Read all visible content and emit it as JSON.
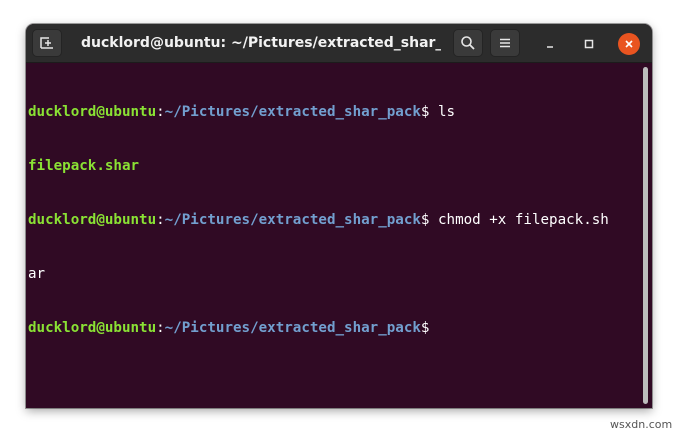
{
  "window": {
    "title": "ducklord@ubuntu: ~/Pictures/extracted_shar_p..."
  },
  "titlebar": {
    "new_tab_icon": "new-tab-icon",
    "search_icon": "search-icon",
    "menu_icon": "hamburger-menu-icon",
    "minimize_icon": "minimize-icon",
    "maximize_icon": "maximize-icon",
    "close_icon": "close-icon"
  },
  "terminal": {
    "lines": [
      {
        "type": "prompt",
        "user": "ducklord@ubuntu",
        "sep": ":",
        "path": "~/Pictures/extracted_shar_pack",
        "sign": "$",
        "cmd": " ls"
      },
      {
        "type": "output",
        "text": "filepack.shar"
      },
      {
        "type": "prompt",
        "user": "ducklord@ubuntu",
        "sep": ":",
        "path": "~/Pictures/extracted_shar_pack",
        "sign": "$",
        "cmd": " chmod +x filepack.sh"
      },
      {
        "type": "plain",
        "text": "ar"
      },
      {
        "type": "prompt",
        "user": "ducklord@ubuntu",
        "sep": ":",
        "path": "~/Pictures/extracted_shar_pack",
        "sign": "$",
        "cmd": ""
      }
    ]
  },
  "colors": {
    "terminal_bg": "#300a24",
    "user_green": "#8ae234",
    "path_blue": "#729fcf",
    "close_orange": "#e95420",
    "titlebar_bg": "#2c2c2c"
  },
  "watermark": "wsxdn.com"
}
